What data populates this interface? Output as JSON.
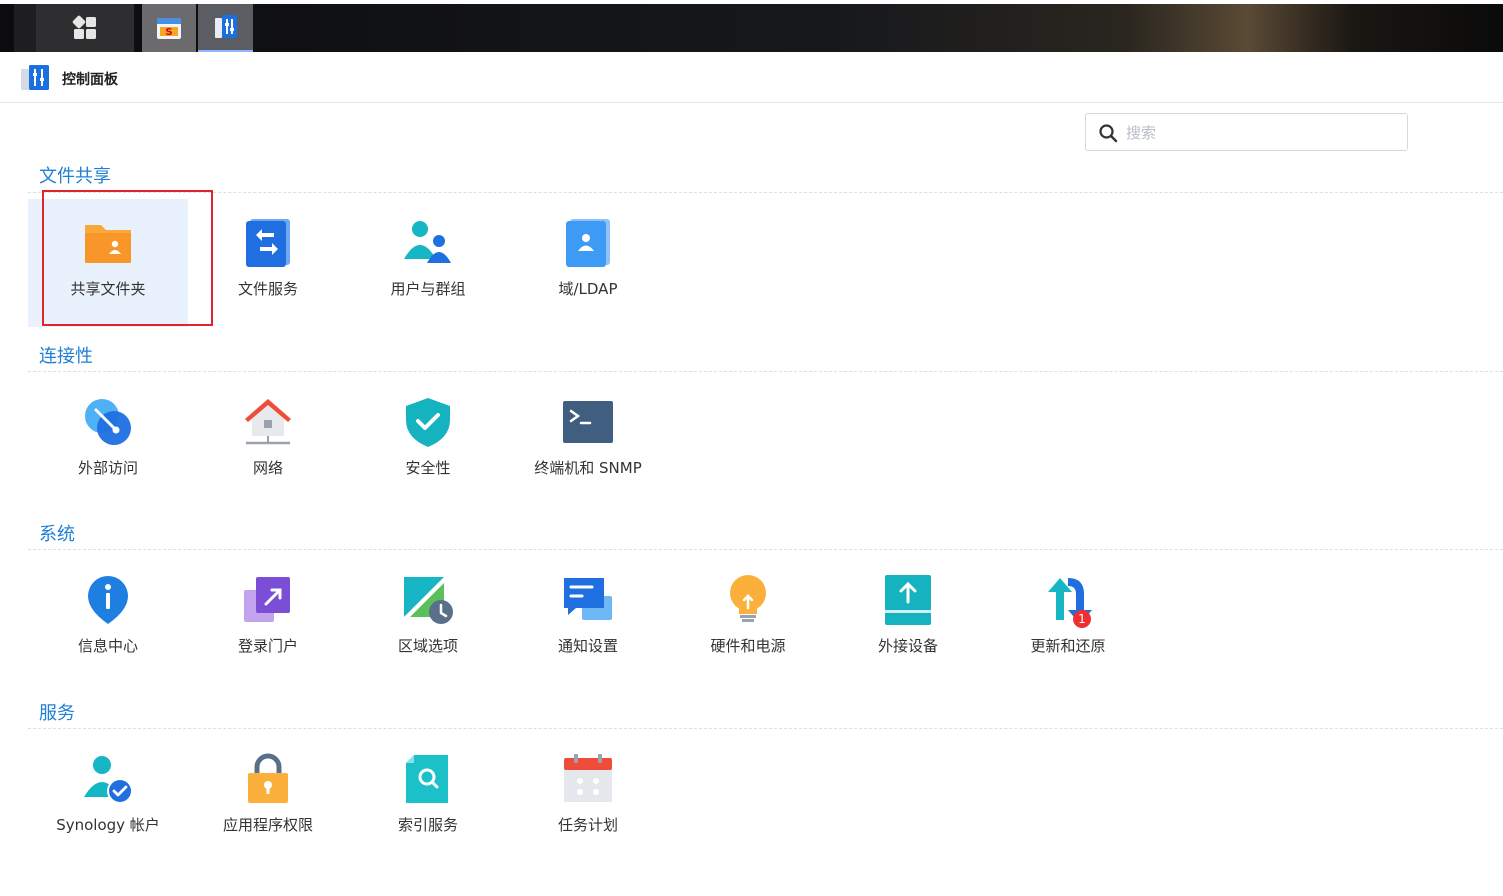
{
  "window": {
    "title": "控制面板"
  },
  "search": {
    "placeholder": "搜索",
    "value": ""
  },
  "sections": [
    {
      "title": "文件共享",
      "items": [
        {
          "label": "共享文件夹",
          "icon": "shared-folder-icon",
          "selected": true
        },
        {
          "label": "文件服务",
          "icon": "file-services-icon"
        },
        {
          "label": "用户与群组",
          "icon": "user-group-icon"
        },
        {
          "label": "域/LDAP",
          "icon": "domain-ldap-icon"
        }
      ]
    },
    {
      "title": "连接性",
      "items": [
        {
          "label": "外部访问",
          "icon": "external-access-icon"
        },
        {
          "label": "网络",
          "icon": "network-icon"
        },
        {
          "label": "安全性",
          "icon": "security-shield-icon"
        },
        {
          "label": "终端机和 SNMP",
          "icon": "terminal-icon"
        }
      ]
    },
    {
      "title": "系统",
      "items": [
        {
          "label": "信息中心",
          "icon": "info-center-icon"
        },
        {
          "label": "登录门户",
          "icon": "login-portal-icon"
        },
        {
          "label": "区域选项",
          "icon": "regional-options-icon"
        },
        {
          "label": "通知设置",
          "icon": "notification-icon"
        },
        {
          "label": "硬件和电源",
          "icon": "hardware-power-icon"
        },
        {
          "label": "外接设备",
          "icon": "external-devices-icon"
        },
        {
          "label": "更新和还原",
          "icon": "update-restore-icon",
          "badge": "1"
        }
      ]
    },
    {
      "title": "服务",
      "items": [
        {
          "label": "Synology 帐户",
          "icon": "synology-account-icon"
        },
        {
          "label": "应用程序权限",
          "icon": "app-privileges-icon"
        },
        {
          "label": "索引服务",
          "icon": "indexing-service-icon"
        },
        {
          "label": "任务计划",
          "icon": "task-scheduler-icon"
        }
      ]
    }
  ],
  "colors": {
    "section_title": "#1f7fd6",
    "selected_bg": "#e8f1fc",
    "highlight": "#e0262b",
    "badge": "#ef2f2f"
  }
}
